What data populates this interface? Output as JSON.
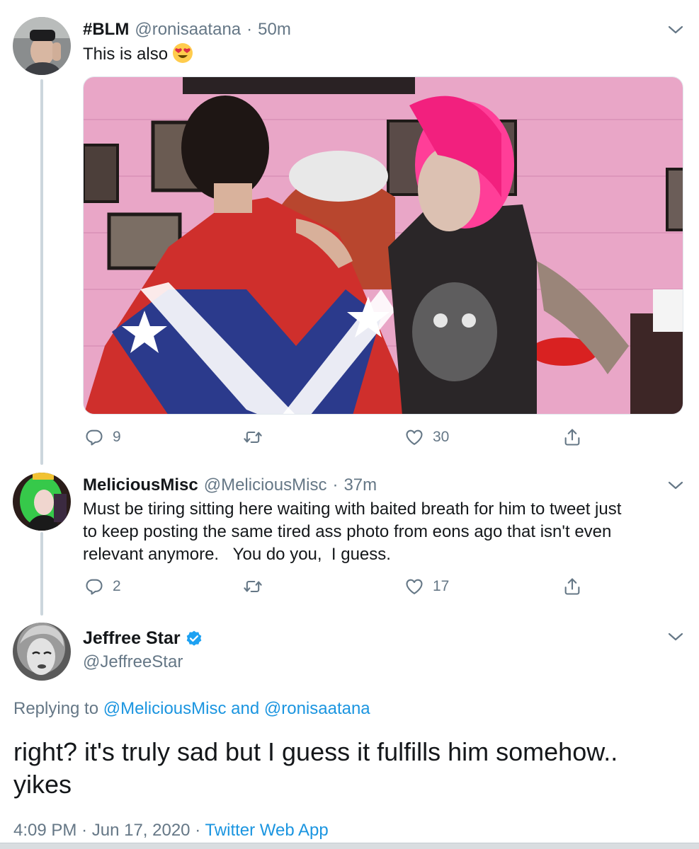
{
  "tweets": [
    {
      "display_name": "#BLM",
      "handle": "@ronisaatana",
      "separator": "·",
      "time": "50m",
      "text": "This is also",
      "emoji": "heart-eyes-emoji",
      "counts": {
        "reply": "9",
        "retweet": "",
        "like": "30"
      }
    },
    {
      "display_name": "MeliciousMisc",
      "handle": "@MeliciousMisc",
      "separator": "·",
      "time": "37m",
      "text_lines": [
        "Must be tiring sitting here waiting with baited breath for him to tweet just",
        "to keep posting the same tired ass photo from eons ago that isn't even",
        "relevant anymore.   You do you,  I guess."
      ],
      "counts": {
        "reply": "2",
        "retweet": "",
        "like": "17"
      }
    }
  ],
  "main_tweet": {
    "display_name": "Jeffree Star",
    "verified": true,
    "handle": "@JeffreeStar",
    "replying_prefix": "Replying to",
    "reply_to_1": "@MeliciousMisc",
    "reply_and": "and",
    "reply_to_2": "@ronisaatana",
    "text_line1": "right? it's truly sad but I guess it fulfills him somehow..",
    "text_line2": "yikes",
    "time": "4:09 PM",
    "separator": "·",
    "date": "Jun 17, 2020",
    "source": "Twitter Web App"
  },
  "colors": {
    "link": "#1b95e0",
    "secondary_text": "#657786",
    "primary_text": "#14171a",
    "verified": "#1da1f2",
    "thread_line": "#ccd6dd"
  },
  "icons": [
    "reply-icon",
    "retweet-icon",
    "like-icon",
    "share-icon",
    "chevron-down-icon",
    "verified-badge-icon"
  ]
}
